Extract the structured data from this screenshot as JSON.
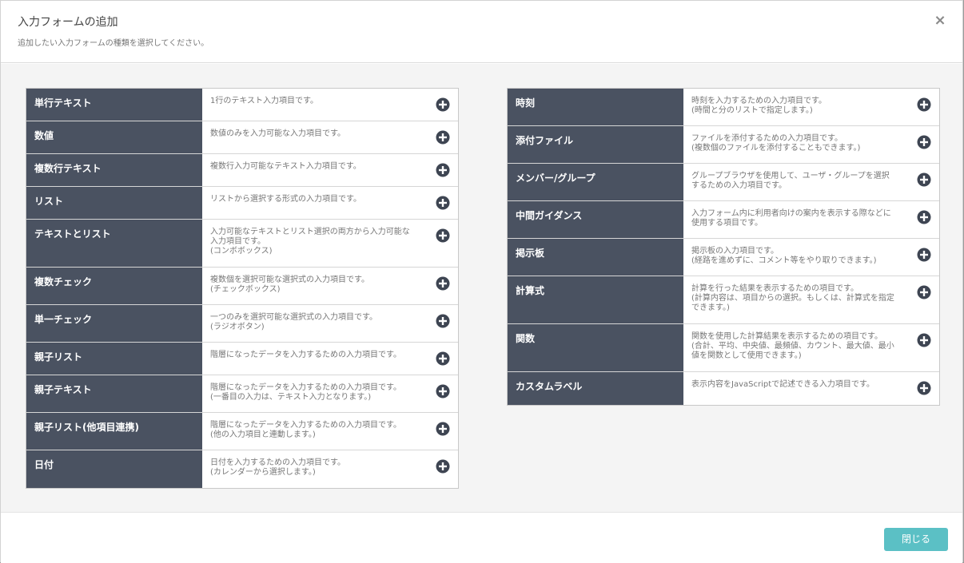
{
  "header": {
    "title": "入力フォームの追加",
    "subtitle": "追加したい入力フォームの種類を選択してください。",
    "close_icon": "×"
  },
  "left_items": [
    {
      "name": "単行テキスト",
      "desc": "1行のテキスト入力項目です。",
      "h": 41
    },
    {
      "name": "数値",
      "desc": "数値のみを入力可能な入力項目です。",
      "h": 41
    },
    {
      "name": "複数行テキスト",
      "desc": "複数行入力可能なテキスト入力項目です。",
      "h": 41
    },
    {
      "name": "リスト",
      "desc": "リストから選択する形式の入力項目です。",
      "h": 41
    },
    {
      "name": "テキストとリスト",
      "desc": "入力可能なテキストとリスト選択の両方から入力可能な\n入力項目です。\n(コンボボックス)",
      "h": 60
    },
    {
      "name": "複数チェック",
      "desc": "複数個を選択可能な選択式の入力項目です。\n(チェックボックス)",
      "h": 47
    },
    {
      "name": "単一チェック",
      "desc": "一つのみを選択可能な選択式の入力項目です。\n(ラジオボタン)",
      "h": 47
    },
    {
      "name": "親子リスト",
      "desc": "階層になったデータを入力するための入力項目です。",
      "h": 41
    },
    {
      "name": "親子テキスト",
      "desc": "階層になったデータを入力するための入力項目です。\n(一番目の入力は、テキスト入力となります。)",
      "h": 47
    },
    {
      "name": "親子リスト(他項目連携)",
      "desc": "階層になったデータを入力するための入力項目です。\n(他の入力項目と連動します。)",
      "h": 47
    },
    {
      "name": "日付",
      "desc": "日付を入力するための入力項目です。\n(カレンダーから選択します。)",
      "h": 47
    }
  ],
  "right_items": [
    {
      "name": "時刻",
      "desc": "時刻を入力するための入力項目です。\n(時間と分のリストで指定します。)",
      "h": 47
    },
    {
      "name": "添付ファイル",
      "desc": "ファイルを添付するための入力項目です。\n(複数個のファイルを添付することもできます。)",
      "h": 47
    },
    {
      "name": "メンバー/グループ",
      "desc": "グループブラウザを使用して、ユーザ・グループを選択\nするための入力項目です。",
      "h": 47
    },
    {
      "name": "中間ガイダンス",
      "desc": "入力フォーム内に利用者向けの案内を表示する際などに\n使用する項目です。",
      "h": 47
    },
    {
      "name": "掲示板",
      "desc": "掲示板の入力項目です。\n(経路を進めずに、コメント等をやり取りできます。)",
      "h": 47
    },
    {
      "name": "計算式",
      "desc": "計算を行った結果を表示するための項目です。\n(計算内容は、項目からの選択。もしくは、計算式を指定\nできます。)",
      "h": 60
    },
    {
      "name": "関数",
      "desc": "関数を使用した計算結果を表示するための項目です。\n(合計、平均、中央値、最頻値、カウント、最大値、最小\n値を関数として使用できます。)",
      "h": 60
    },
    {
      "name": "カスタムラベル",
      "desc": "表示内容をJavaScriptで記述できる入力項目です。",
      "h": 41
    }
  ],
  "footer": {
    "close_label": "閉じる"
  },
  "colors": {
    "name_bg": "#4a5261",
    "accent": "#5bc0c5"
  },
  "icons": {
    "add": "plus-circle-icon",
    "close": "close-icon"
  }
}
